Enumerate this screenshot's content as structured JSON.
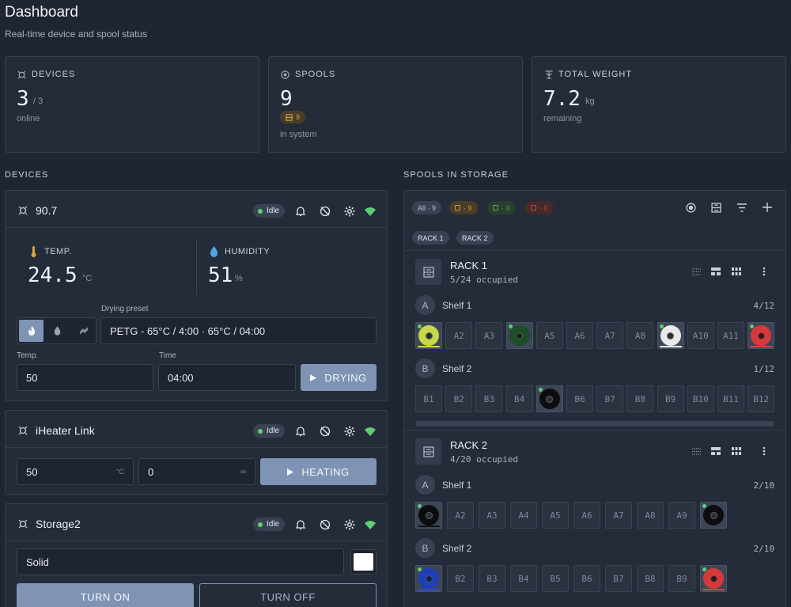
{
  "header": {
    "title": "Dashboard",
    "subtitle": "Real-time device and spool status"
  },
  "stats": {
    "devices": {
      "label": "DEVICES",
      "value": "3",
      "total": "/ 3",
      "note": "online"
    },
    "spools": {
      "label": "SPOOLS",
      "value": "9",
      "badge": "9",
      "note": "in system"
    },
    "weight": {
      "label": "TOTAL WEIGHT",
      "value": "7.2",
      "unit": "kg",
      "note": "remaining"
    }
  },
  "devices_section": {
    "title": "DEVICES"
  },
  "device1": {
    "name": "90.7",
    "status": "Idle",
    "temp_label": "TEMP.",
    "temp_value": "24.5",
    "temp_unit": "°C",
    "hum_label": "HUMIDITY",
    "hum_value": "51",
    "hum_unit": "%",
    "preset_label": "Drying preset",
    "preset_value": "PETG - 65°C / 4:00 · 65°C / 04:00",
    "temp_field_label": "Temp.",
    "temp_field_value": "50",
    "time_field_label": "Time",
    "time_field_value": "04:00",
    "action_label": "DRYING"
  },
  "device2": {
    "name": "iHeater Link",
    "status": "Idle",
    "temp_value": "50",
    "temp_unit": "°C",
    "second_value": "0",
    "second_unit": "∞",
    "action_label": "HEATING"
  },
  "device3": {
    "name": "Storage2",
    "status": "Idle",
    "mode_value": "Solid",
    "on_label": "TURN ON",
    "off_label": "TURN OFF"
  },
  "spools_section": {
    "title": "SPOOLS IN STORAGE",
    "filters": [
      {
        "label": "All · 9",
        "color": "#3a4252",
        "text": "#b9c1cd"
      },
      {
        "label": "· 9",
        "color": "#4a3d28",
        "text": "#c79b4f"
      },
      {
        "label": "· 0",
        "color": "#2a3d2e",
        "text": "#5f9d68"
      },
      {
        "label": "· 0",
        "color": "#45292c",
        "text": "#b84a4a"
      }
    ],
    "rack_tabs": [
      "RACK 1",
      "RACK 2"
    ]
  },
  "rack1": {
    "name": "RACK 1",
    "occupied": "5/24 occupied",
    "shelves": [
      {
        "letter": "A",
        "name": "Shelf 1",
        "count": "4/12",
        "slots": [
          {
            "label": "A1",
            "color": "#c7d84a",
            "hole": "#2a3020",
            "bar": "#d7d93c"
          },
          {
            "label": "A2"
          },
          {
            "label": "A3"
          },
          {
            "label": "A4",
            "color": "#1f4d2a",
            "hole": "#14281a",
            "bar": ""
          },
          {
            "label": "A5"
          },
          {
            "label": "A6"
          },
          {
            "label": "A7"
          },
          {
            "label": "A8"
          },
          {
            "label": "A9",
            "color": "#e9e9e9",
            "hole": "#2a2e36",
            "bar": "#f2f2f2"
          },
          {
            "label": "A10"
          },
          {
            "label": "A11"
          },
          {
            "label": "A12",
            "color": "#d8383a",
            "hole": "#3a1414",
            "bar": "#e04040"
          }
        ]
      },
      {
        "letter": "B",
        "name": "Shelf 2",
        "count": "1/12",
        "slots": [
          {
            "label": "B1"
          },
          {
            "label": "B2"
          },
          {
            "label": "B3"
          },
          {
            "label": "B4"
          },
          {
            "label": "B5",
            "color": "#0d0d0f",
            "hole": "#2a2e36",
            "bar": ""
          },
          {
            "label": "B6"
          },
          {
            "label": "B7"
          },
          {
            "label": "B8"
          },
          {
            "label": "B9"
          },
          {
            "label": "B10"
          },
          {
            "label": "B11"
          },
          {
            "label": "B12"
          }
        ]
      }
    ]
  },
  "rack2": {
    "name": "RACK 2",
    "occupied": "4/20 occupied",
    "shelves": [
      {
        "letter": "A",
        "name": "Shelf 1",
        "count": "2/10",
        "slots": [
          {
            "label": "A1",
            "color": "#0d0d0f",
            "hole": "#2a2e36",
            "bar": "#111111"
          },
          {
            "label": "A2"
          },
          {
            "label": "A3"
          },
          {
            "label": "A4"
          },
          {
            "label": "A5"
          },
          {
            "label": "A6"
          },
          {
            "label": "A7"
          },
          {
            "label": "A8"
          },
          {
            "label": "A9"
          },
          {
            "label": "A10",
            "color": "#0d0d0f",
            "hole": "#2a2e36",
            "bar": ""
          }
        ]
      },
      {
        "letter": "B",
        "name": "Shelf 2",
        "count": "2/10",
        "slots": [
          {
            "label": "B1",
            "color": "#1f3fb8",
            "hole": "#10204a",
            "bar": "#2c4fd0"
          },
          {
            "label": "B2"
          },
          {
            "label": "B3"
          },
          {
            "label": "B4"
          },
          {
            "label": "B5"
          },
          {
            "label": "B6"
          },
          {
            "label": "B7"
          },
          {
            "label": "B8"
          },
          {
            "label": "B9"
          },
          {
            "label": "B10",
            "color": "#d8383a",
            "hole": "#3a1414",
            "bar": "#e04040"
          }
        ]
      }
    ]
  }
}
